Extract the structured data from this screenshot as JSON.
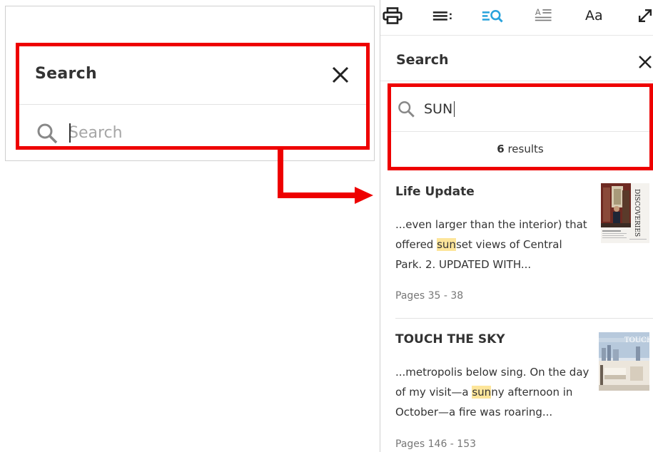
{
  "toolbar": {
    "icons": [
      "print-icon",
      "table-of-contents-icon",
      "search-icon",
      "text-view-icon",
      "font-size-icon",
      "fullscreen-icon"
    ],
    "font_label": "Aa",
    "active_color": "#29a3dc"
  },
  "left_panel": {
    "title": "Search",
    "search_placeholder": "Search",
    "search_value": ""
  },
  "right_panel": {
    "title": "Search",
    "search_value": "SUN",
    "results_count": "6",
    "results_label": "results",
    "results": [
      {
        "title": "Life Update",
        "snippet_before": "...even larger than the interior) that offered ",
        "highlight": "sun",
        "snippet_after": "set views of Central Park. 2. UPDATED WITH...",
        "pages": "Pages 35 - 38"
      },
      {
        "title": "TOUCH THE SKY",
        "snippet_before": "...metropolis below sing. On the day of my visit—a ",
        "highlight": "sun",
        "snippet_after": "ny afternoon in October—a fire was roaring...",
        "pages": "Pages 146 - 153"
      }
    ]
  },
  "colors": {
    "highlight_box": "#ee0000",
    "match_highlight": "#fde59a"
  }
}
